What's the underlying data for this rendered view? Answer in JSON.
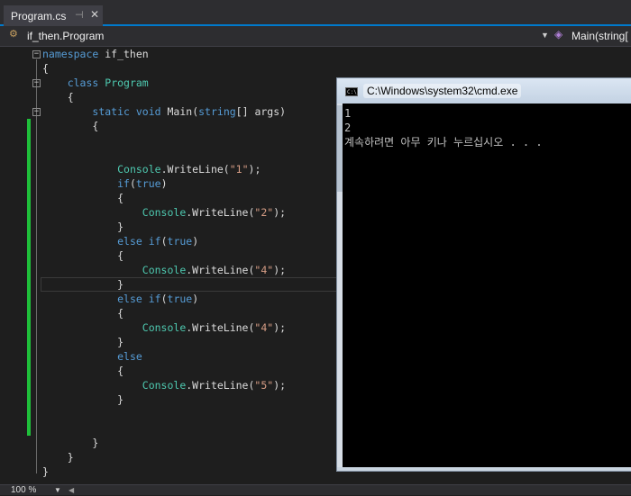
{
  "tab": {
    "title": "Program.cs",
    "pin_icon": "pin-icon",
    "close_icon": "close-icon"
  },
  "navbar": {
    "left": "if_then.Program",
    "right": "Main(string[",
    "left_icon": "class-icon",
    "right_icon": "method-icon"
  },
  "code": {
    "lines": [
      [
        "kw:namespace",
        " if_then"
      ],
      [
        "{"
      ],
      [
        "    ",
        "kw:class",
        " ",
        "ty:Program"
      ],
      [
        "    {"
      ],
      [
        "        ",
        "kw:static",
        " ",
        "kw:void",
        " Main(",
        "kw:string",
        "[] args)"
      ],
      [
        "        {"
      ],
      [
        ""
      ],
      [
        ""
      ],
      [
        "            ",
        "ty:Console",
        ".WriteLine(",
        "st:\"1\"",
        ");"
      ],
      [
        "            ",
        "kw:if",
        "(",
        "kw:true",
        ")"
      ],
      [
        "            {"
      ],
      [
        "                ",
        "ty:Console",
        ".WriteLine(",
        "st:\"2\"",
        ");"
      ],
      [
        "            }"
      ],
      [
        "            ",
        "kw:else",
        " ",
        "kw:if",
        "(",
        "kw:true",
        ")"
      ],
      [
        "            {"
      ],
      [
        "                ",
        "ty:Console",
        ".WriteLine(",
        "st:\"4\"",
        ");"
      ],
      [
        "            }"
      ],
      [
        "            ",
        "kw:else",
        " ",
        "kw:if",
        "(",
        "kw:true",
        ")"
      ],
      [
        "            {"
      ],
      [
        "                ",
        "ty:Console",
        ".WriteLine(",
        "st:\"4\"",
        ");"
      ],
      [
        "            }"
      ],
      [
        "            ",
        "kw:else"
      ],
      [
        "            {"
      ],
      [
        "                ",
        "ty:Console",
        ".WriteLine(",
        "st:\"5\"",
        ");"
      ],
      [
        "            }"
      ],
      [
        ""
      ],
      [
        ""
      ],
      [
        "        }"
      ],
      [
        "    }"
      ],
      [
        "}"
      ]
    ]
  },
  "console": {
    "title": "C:\\Windows\\system32\\cmd.exe",
    "icon_text": "C:\\",
    "output": [
      "1",
      "2",
      "계속하려면 아무 키나 누르십시오 . . ."
    ]
  },
  "status": {
    "zoom": "100 %"
  },
  "colors": {
    "keyword": "#569cd6",
    "type": "#4ec9b0",
    "string": "#d69d85",
    "change_bar": "#1fbf3a"
  }
}
